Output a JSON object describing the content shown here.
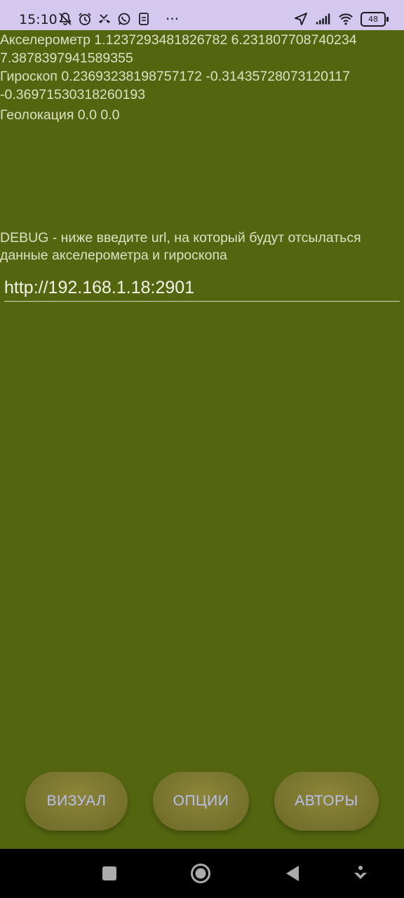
{
  "status_bar": {
    "time": "15:10",
    "icons_left": [
      "muted-bell-icon",
      "alarm-icon",
      "missed-call-icon",
      "whatsapp-icon",
      "sim-icon"
    ],
    "more": "···",
    "battery": "48",
    "icons_right": [
      "location-arrow-icon",
      "signal-icon",
      "wifi-icon",
      "battery-icon"
    ]
  },
  "sensors": {
    "accelerometer_line1": "Акселерометр 1.1237293481826782 6.231807708740234",
    "accelerometer_line2": "7.3878397941589355",
    "gyroscope_line1": "Гироскоп 0.23693238198757172 -0.31435728073120117",
    "gyroscope_line2": "-0.36971530318260193",
    "geolocation": "Геолокация 0.0 0.0"
  },
  "debug": {
    "line1": "DEBUG - ниже введите url, на который будут отсылаться",
    "line2": "данные акселерометра и гироскопа",
    "url_value": "http://192.168.1.18:2901"
  },
  "buttons": {
    "visual": "ВИЗУАЛ",
    "options": "ОПЦИИ",
    "authors": "АВТОРЫ"
  },
  "colors": {
    "background": "#53660f",
    "status_bar": "#d4c8ee",
    "button_fill": "#7a7630",
    "button_text": "#b8bff2"
  }
}
